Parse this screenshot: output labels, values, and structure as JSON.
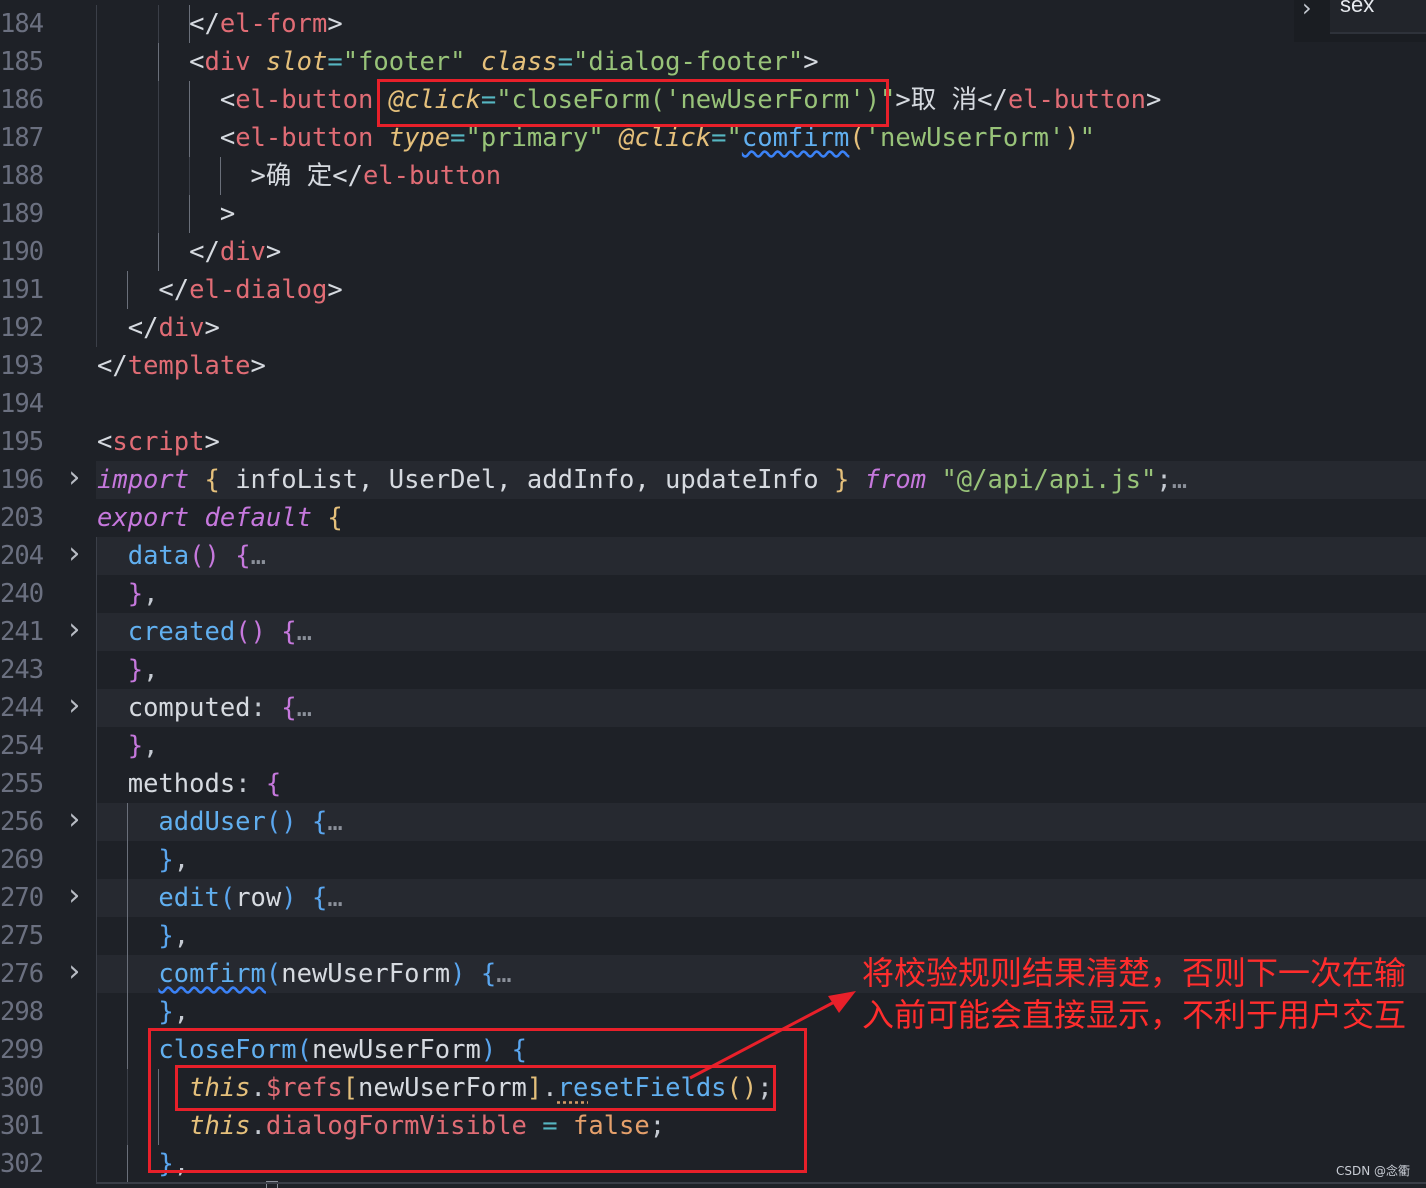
{
  "editor": {
    "lines": [
      {
        "num": "184",
        "fold": false,
        "hl": false,
        "guides": [
          96,
          158,
          189
        ],
        "tokens": [
          {
            "t": "      ",
            "c": "var"
          },
          {
            "t": "</",
            "c": "br"
          },
          {
            "t": "el-form",
            "c": "tag"
          },
          {
            "t": ">",
            "c": "br"
          }
        ]
      },
      {
        "num": "185",
        "fold": false,
        "hl": false,
        "guides": [
          96,
          158
        ],
        "tokens": [
          {
            "t": "      ",
            "c": "var"
          },
          {
            "t": "<",
            "c": "br"
          },
          {
            "t": "div",
            "c": "tag"
          },
          {
            "t": " ",
            "c": "var"
          },
          {
            "t": "slot",
            "c": "attr"
          },
          {
            "t": "=",
            "c": "eq"
          },
          {
            "t": "\"footer\"",
            "c": "str"
          },
          {
            "t": " ",
            "c": "var"
          },
          {
            "t": "class",
            "c": "attr"
          },
          {
            "t": "=",
            "c": "eq"
          },
          {
            "t": "\"dialog-footer\"",
            "c": "str"
          },
          {
            "t": ">",
            "c": "br"
          }
        ]
      },
      {
        "num": "186",
        "fold": false,
        "hl": false,
        "guides": [
          96,
          158,
          189
        ],
        "tokens": [
          {
            "t": "        ",
            "c": "var"
          },
          {
            "t": "<",
            "c": "br"
          },
          {
            "t": "el-button",
            "c": "tag"
          },
          {
            "t": " ",
            "c": "var"
          },
          {
            "t": "@click",
            "c": "attr"
          },
          {
            "t": "=",
            "c": "eq"
          },
          {
            "t": "\"closeForm(",
            "c": "str"
          },
          {
            "t": "'newUserForm'",
            "c": "str"
          },
          {
            "t": ")\"",
            "c": "str"
          },
          {
            "t": ">取 消</",
            "c": "br"
          },
          {
            "t": "el-button",
            "c": "tag"
          },
          {
            "t": ">",
            "c": "br"
          }
        ]
      },
      {
        "num": "187",
        "fold": false,
        "hl": false,
        "guides": [
          96,
          158,
          189
        ],
        "tokens": [
          {
            "t": "        ",
            "c": "var"
          },
          {
            "t": "<",
            "c": "br"
          },
          {
            "t": "el-button",
            "c": "tag"
          },
          {
            "t": " ",
            "c": "var"
          },
          {
            "t": "type",
            "c": "attr"
          },
          {
            "t": "=",
            "c": "eq"
          },
          {
            "t": "\"primary\"",
            "c": "str"
          },
          {
            "t": " ",
            "c": "var"
          },
          {
            "t": "@click",
            "c": "attr"
          },
          {
            "t": "=",
            "c": "eq"
          },
          {
            "t": "\"",
            "c": "str"
          },
          {
            "t": "comfirm",
            "c": "fn",
            "sq": true
          },
          {
            "t": "(",
            "c": "p1"
          },
          {
            "t": "'newUserForm'",
            "c": "str"
          },
          {
            "t": ")",
            "c": "p1"
          },
          {
            "t": "\"",
            "c": "str"
          }
        ]
      },
      {
        "num": "188",
        "fold": false,
        "hl": false,
        "guides": [
          96,
          158,
          189,
          220
        ],
        "tokens": [
          {
            "t": "          ",
            "c": "var"
          },
          {
            "t": ">确 定</",
            "c": "br"
          },
          {
            "t": "el-button",
            "c": "tag"
          }
        ]
      },
      {
        "num": "189",
        "fold": false,
        "hl": false,
        "guides": [
          96,
          158,
          189
        ],
        "tokens": [
          {
            "t": "        ",
            "c": "var"
          },
          {
            "t": ">",
            "c": "br"
          }
        ]
      },
      {
        "num": "190",
        "fold": false,
        "hl": false,
        "guides": [
          96,
          158
        ],
        "tokens": [
          {
            "t": "      ",
            "c": "var"
          },
          {
            "t": "</",
            "c": "br"
          },
          {
            "t": "div",
            "c": "tag"
          },
          {
            "t": ">",
            "c": "br"
          }
        ]
      },
      {
        "num": "191",
        "fold": false,
        "hl": false,
        "guides": [
          96,
          127
        ],
        "tokens": [
          {
            "t": "    ",
            "c": "var"
          },
          {
            "t": "</",
            "c": "br"
          },
          {
            "t": "el-dialog",
            "c": "tag"
          },
          {
            "t": ">",
            "c": "br"
          }
        ]
      },
      {
        "num": "192",
        "fold": false,
        "hl": false,
        "guides": [
          96
        ],
        "tokens": [
          {
            "t": "  ",
            "c": "var"
          },
          {
            "t": "</",
            "c": "br"
          },
          {
            "t": "div",
            "c": "tag"
          },
          {
            "t": ">",
            "c": "br"
          }
        ]
      },
      {
        "num": "193",
        "fold": false,
        "hl": false,
        "guides": [],
        "tokens": [
          {
            "t": "</",
            "c": "br"
          },
          {
            "t": "template",
            "c": "tag"
          },
          {
            "t": ">",
            "c": "br"
          }
        ]
      },
      {
        "num": "194",
        "fold": false,
        "hl": false,
        "guides": [],
        "tokens": []
      },
      {
        "num": "195",
        "fold": false,
        "hl": false,
        "guides": [],
        "tokens": [
          {
            "t": "<",
            "c": "br"
          },
          {
            "t": "script",
            "c": "tag"
          },
          {
            "t": ">",
            "c": "br"
          }
        ]
      },
      {
        "num": "196",
        "fold": true,
        "hl": true,
        "guides": [],
        "tokens": [
          {
            "t": "import",
            "c": "kw"
          },
          {
            "t": " ",
            "c": "var"
          },
          {
            "t": "{",
            "c": "p1"
          },
          {
            "t": " infoList, UserDel, addInfo, updateInfo ",
            "c": "var"
          },
          {
            "t": "}",
            "c": "p1"
          },
          {
            "t": " ",
            "c": "var"
          },
          {
            "t": "from",
            "c": "kw"
          },
          {
            "t": " ",
            "c": "var"
          },
          {
            "t": "\"@/api/api.js\"",
            "c": "str"
          },
          {
            "t": ";",
            "c": "punc"
          },
          {
            "t": "…",
            "c": "dots"
          }
        ]
      },
      {
        "num": "203",
        "fold": false,
        "hl": false,
        "guides": [],
        "tokens": [
          {
            "t": "export",
            "c": "kw"
          },
          {
            "t": " ",
            "c": "var"
          },
          {
            "t": "default",
            "c": "kw"
          },
          {
            "t": " ",
            "c": "var"
          },
          {
            "t": "{",
            "c": "p1"
          }
        ]
      },
      {
        "num": "204",
        "fold": true,
        "hl": true,
        "guides": [
          96
        ],
        "tokens": [
          {
            "t": "  ",
            "c": "var"
          },
          {
            "t": "data",
            "c": "fn"
          },
          {
            "t": "()",
            "c": "p2"
          },
          {
            "t": " ",
            "c": "var"
          },
          {
            "t": "{",
            "c": "p2"
          },
          {
            "t": "…",
            "c": "dots"
          }
        ]
      },
      {
        "num": "240",
        "fold": false,
        "hl": false,
        "guides": [
          96
        ],
        "tokens": [
          {
            "t": "  ",
            "c": "var"
          },
          {
            "t": "}",
            "c": "p2"
          },
          {
            "t": ",",
            "c": "punc"
          }
        ]
      },
      {
        "num": "241",
        "fold": true,
        "hl": true,
        "guides": [
          96
        ],
        "tokens": [
          {
            "t": "  ",
            "c": "var"
          },
          {
            "t": "created",
            "c": "fn"
          },
          {
            "t": "()",
            "c": "p2"
          },
          {
            "t": " ",
            "c": "var"
          },
          {
            "t": "{",
            "c": "p2"
          },
          {
            "t": "…",
            "c": "dots"
          }
        ]
      },
      {
        "num": "243",
        "fold": false,
        "hl": false,
        "guides": [
          96
        ],
        "tokens": [
          {
            "t": "  ",
            "c": "var"
          },
          {
            "t": "}",
            "c": "p2"
          },
          {
            "t": ",",
            "c": "punc"
          }
        ]
      },
      {
        "num": "244",
        "fold": true,
        "hl": true,
        "guides": [
          96
        ],
        "tokens": [
          {
            "t": "  ",
            "c": "var"
          },
          {
            "t": "computed",
            "c": "var"
          },
          {
            "t": ":",
            "c": "punc"
          },
          {
            "t": " ",
            "c": "var"
          },
          {
            "t": "{",
            "c": "p2"
          },
          {
            "t": "…",
            "c": "dots"
          }
        ]
      },
      {
        "num": "254",
        "fold": false,
        "hl": false,
        "guides": [
          96
        ],
        "tokens": [
          {
            "t": "  ",
            "c": "var"
          },
          {
            "t": "}",
            "c": "p2"
          },
          {
            "t": ",",
            "c": "punc"
          }
        ]
      },
      {
        "num": "255",
        "fold": false,
        "hl": false,
        "guides": [
          96
        ],
        "tokens": [
          {
            "t": "  ",
            "c": "var"
          },
          {
            "t": "methods",
            "c": "var"
          },
          {
            "t": ":",
            "c": "punc"
          },
          {
            "t": " ",
            "c": "var"
          },
          {
            "t": "{",
            "c": "p2"
          }
        ]
      },
      {
        "num": "256",
        "fold": true,
        "hl": true,
        "guides": [
          96,
          127
        ],
        "tokens": [
          {
            "t": "    ",
            "c": "var"
          },
          {
            "t": "addUser",
            "c": "fn"
          },
          {
            "t": "()",
            "c": "p3"
          },
          {
            "t": " ",
            "c": "var"
          },
          {
            "t": "{",
            "c": "p3"
          },
          {
            "t": "…",
            "c": "dots"
          }
        ]
      },
      {
        "num": "269",
        "fold": false,
        "hl": false,
        "guides": [
          96,
          127
        ],
        "tokens": [
          {
            "t": "    ",
            "c": "var"
          },
          {
            "t": "}",
            "c": "p3"
          },
          {
            "t": ",",
            "c": "punc"
          }
        ]
      },
      {
        "num": "270",
        "fold": true,
        "hl": true,
        "guides": [
          96,
          127
        ],
        "tokens": [
          {
            "t": "    ",
            "c": "var"
          },
          {
            "t": "edit",
            "c": "fn"
          },
          {
            "t": "(",
            "c": "p3"
          },
          {
            "t": "row",
            "c": "var"
          },
          {
            "t": ")",
            "c": "p3"
          },
          {
            "t": " ",
            "c": "var"
          },
          {
            "t": "{",
            "c": "p3"
          },
          {
            "t": "…",
            "c": "dots"
          }
        ]
      },
      {
        "num": "275",
        "fold": false,
        "hl": false,
        "guides": [
          96,
          127
        ],
        "tokens": [
          {
            "t": "    ",
            "c": "var"
          },
          {
            "t": "}",
            "c": "p3"
          },
          {
            "t": ",",
            "c": "punc"
          }
        ]
      },
      {
        "num": "276",
        "fold": true,
        "hl": true,
        "guides": [
          96,
          127
        ],
        "tokens": [
          {
            "t": "    ",
            "c": "var"
          },
          {
            "t": "comfirm",
            "c": "fn",
            "sq": true
          },
          {
            "t": "(",
            "c": "p3"
          },
          {
            "t": "newUserForm",
            "c": "var"
          },
          {
            "t": ")",
            "c": "p3"
          },
          {
            "t": " ",
            "c": "var"
          },
          {
            "t": "{",
            "c": "p3"
          },
          {
            "t": "…",
            "c": "dots"
          }
        ]
      },
      {
        "num": "298",
        "fold": false,
        "hl": false,
        "guides": [
          96,
          127
        ],
        "tokens": [
          {
            "t": "    ",
            "c": "var"
          },
          {
            "t": "}",
            "c": "p3"
          },
          {
            "t": ",",
            "c": "punc"
          }
        ]
      },
      {
        "num": "299",
        "fold": false,
        "hl": false,
        "guides": [
          96,
          127
        ],
        "tokens": [
          {
            "t": "    ",
            "c": "var"
          },
          {
            "t": "closeForm",
            "c": "fn"
          },
          {
            "t": "(",
            "c": "p3"
          },
          {
            "t": "newUserForm",
            "c": "var"
          },
          {
            "t": ")",
            "c": "p3"
          },
          {
            "t": " ",
            "c": "var"
          },
          {
            "t": "{",
            "c": "p3"
          }
        ]
      },
      {
        "num": "300",
        "fold": false,
        "hl": false,
        "guides": [
          96,
          127,
          158
        ],
        "tokens": [
          {
            "t": "      ",
            "c": "var"
          },
          {
            "t": "this",
            "c": "this"
          },
          {
            "t": ".",
            "c": "punc"
          },
          {
            "t": "$refs",
            "c": "prop"
          },
          {
            "t": "[",
            "c": "p1"
          },
          {
            "t": "newUserForm",
            "c": "var"
          },
          {
            "t": "]",
            "c": "p1"
          },
          {
            "t": ".",
            "c": "punc"
          },
          {
            "t": "re",
            "c": "fn",
            "dot": true
          },
          {
            "t": "setFields",
            "c": "fn"
          },
          {
            "t": "()",
            "c": "p1"
          },
          {
            "t": ";",
            "c": "punc"
          }
        ]
      },
      {
        "num": "301",
        "fold": false,
        "hl": false,
        "guides": [
          96,
          127,
          158
        ],
        "tokens": [
          {
            "t": "      ",
            "c": "var"
          },
          {
            "t": "this",
            "c": "this"
          },
          {
            "t": ".",
            "c": "punc"
          },
          {
            "t": "dialogFormVisible",
            "c": "prop"
          },
          {
            "t": " ",
            "c": "var"
          },
          {
            "t": "=",
            "c": "eq"
          },
          {
            "t": " ",
            "c": "var"
          },
          {
            "t": "false",
            "c": "bool"
          },
          {
            "t": ";",
            "c": "punc"
          }
        ]
      },
      {
        "num": "302",
        "fold": false,
        "hl": false,
        "guides": [
          96,
          127
        ],
        "tokens": [
          {
            "t": "    ",
            "c": "var"
          },
          {
            "t": "}",
            "c": "p3"
          },
          {
            "t": ",",
            "c": "punc"
          }
        ]
      }
    ]
  },
  "find_widget": {
    "value": "sex"
  },
  "annotation": {
    "text": "将校验规则结果清楚，否则下一次在输入前可能会直接显示，不利于用户交互"
  },
  "watermark": {
    "text": "CSDN @念衢"
  },
  "colors": {
    "annotation_red": "#e8202a",
    "background": "#1e2127"
  }
}
